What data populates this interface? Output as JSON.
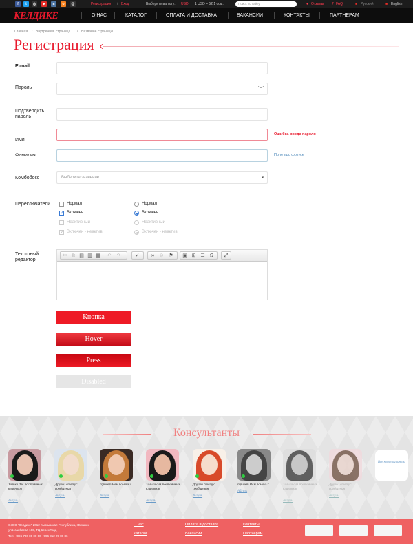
{
  "topbar": {
    "register": "Регистрация",
    "separator": "/",
    "login": "Вход",
    "currency_label": "Выберите валюту:",
    "currency": "USD",
    "rate": "1 USD = 52.1 сом.",
    "search_placeholder": "Поиск по сайту",
    "reviews": "Отзывы",
    "faq": "FAQ",
    "lang_ru": "Русский",
    "lang_en": "English"
  },
  "logo": "КЕЛДИКЕ",
  "nav": [
    "О НАС",
    "КАТАЛОГ",
    "ОПЛАТА И ДОСТАВКА",
    "ВАКАНСИИ",
    "КОНТАКТЫ",
    "ПАРТНЕРАМ"
  ],
  "breadcrumb": [
    "Главная",
    "Внутренняя страница",
    "Название страницы"
  ],
  "page_title": "Регистрация",
  "form": {
    "email": "E-mail",
    "password": "Пароль",
    "confirm": "Подтвердить пароль",
    "confirm_line1": "Подтвердить",
    "confirm_line2": "пароль",
    "name": "Имя",
    "name_error": "Ошибка ввода пароля",
    "surname": "Фамилия",
    "surname_hint": "Поле про фокусе",
    "combo": "Комбобокс",
    "combo_placeholder": "Выберите значение...",
    "switches": "Переключатели",
    "checkbox_normal": "Нормал",
    "checkbox_on": "Включен",
    "checkbox_inactive": "Неактивный",
    "checkbox_on_inactive": "Включен - неактив",
    "radio_normal": "Нормал",
    "radio_on": "Включен",
    "radio_inactive": "Неактивный",
    "radio_on_inactive": "Включен - неактив",
    "editor_line1": "Текстовый",
    "editor_line2": "редактор"
  },
  "buttons": {
    "normal": "Кнопка",
    "hover": "Hover",
    "press": "Press",
    "disabled": "Disabled"
  },
  "consultants": {
    "title": "Консультанты",
    "all": "Все консультанты",
    "items": [
      {
        "quote": "Только для постоянных клиентов",
        "name": "Айгуль",
        "online": true,
        "active": true
      },
      {
        "quote": "Другой статус сообщения",
        "name": "Айгуль",
        "online": true,
        "active": true
      },
      {
        "quote": "Привет Вам помочь?",
        "name": "Айгуль",
        "online": true,
        "active": true
      },
      {
        "quote": "Только для постоянных клиентов",
        "name": "Айгуль",
        "online": true,
        "active": true
      },
      {
        "quote": "Другой статус сообщения",
        "name": "Айгуль",
        "online": true,
        "active": true
      },
      {
        "quote": "Привет Вам помочь?",
        "name": "Айгуль",
        "online": true,
        "active": true
      },
      {
        "quote": "Только для постоянных клиентов",
        "name": "Айгуль",
        "online": false,
        "active": false
      },
      {
        "quote": "Другой статус сообщения",
        "name": "Айгуль",
        "online": false,
        "active": false
      }
    ]
  },
  "footer": {
    "company": "ОсОО \"Келдике\" 2012 Кыргызская Республика, г.Бишкек",
    "address": "ул.Исанбаева 106, ТЦ БеренГилд",
    "phone": "Тел: +996 700 00 00 00    +996 312 29 86 86",
    "links": [
      "О нас",
      "Каталог",
      "Оплата и доставка",
      "Вакансии",
      "Контакты",
      "Партнерам"
    ]
  },
  "colors": {
    "accent": "#e8192c",
    "footer": "#ef6162",
    "nav": "#0d0d0d"
  }
}
